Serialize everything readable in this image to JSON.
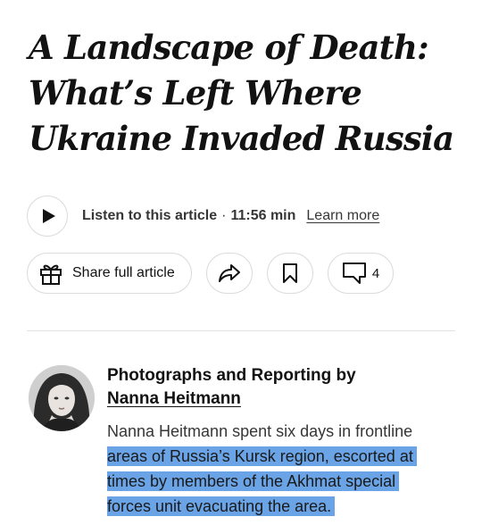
{
  "article": {
    "headline_lines": [
      "A Landscape of Death:",
      "What’s Left Where",
      "Ukraine Invaded Russia"
    ]
  },
  "audio": {
    "listen_label": "Listen to this article",
    "separator": "·",
    "duration": "11:56 min",
    "learn_more": "Learn more",
    "icon": "play-icon"
  },
  "actions": {
    "share_full_label": "Share full article",
    "share_full_icon": "gift-icon",
    "share_icon": "share-arrow-icon",
    "bookmark_icon": "bookmark-icon",
    "comments_icon": "comment-icon",
    "comments_count": "4"
  },
  "byline": {
    "credit_label": "Photographs and Reporting by",
    "author_name": "Nanna Heitmann",
    "bio_lines": [
      "Nanna Heitmann spent six days in frontline",
      "areas of Russia’s Kursk region, escorted at",
      "times by members of the Akhmat special",
      "forces unit evacuating the area."
    ],
    "highlight_color": "#6aa4e6"
  }
}
